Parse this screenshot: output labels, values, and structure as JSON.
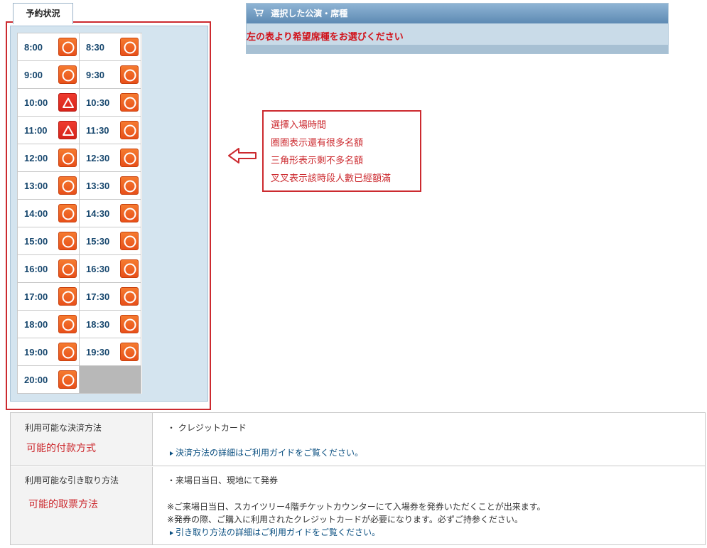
{
  "tab": {
    "label": "予約状況"
  },
  "schedule": {
    "rows": [
      [
        {
          "time": "8:00",
          "status": "circle"
        },
        {
          "time": "8:30",
          "status": "circle"
        }
      ],
      [
        {
          "time": "9:00",
          "status": "circle"
        },
        {
          "time": "9:30",
          "status": "circle"
        }
      ],
      [
        {
          "time": "10:00",
          "status": "triangle"
        },
        {
          "time": "10:30",
          "status": "circle"
        }
      ],
      [
        {
          "time": "11:00",
          "status": "triangle"
        },
        {
          "time": "11:30",
          "status": "circle"
        }
      ],
      [
        {
          "time": "12:00",
          "status": "circle"
        },
        {
          "time": "12:30",
          "status": "circle"
        }
      ],
      [
        {
          "time": "13:00",
          "status": "circle"
        },
        {
          "time": "13:30",
          "status": "circle"
        }
      ],
      [
        {
          "time": "14:00",
          "status": "circle"
        },
        {
          "time": "14:30",
          "status": "circle"
        }
      ],
      [
        {
          "time": "15:00",
          "status": "circle"
        },
        {
          "time": "15:30",
          "status": "circle"
        }
      ],
      [
        {
          "time": "16:00",
          "status": "circle"
        },
        {
          "time": "16:30",
          "status": "circle"
        }
      ],
      [
        {
          "time": "17:00",
          "status": "circle"
        },
        {
          "time": "17:30",
          "status": "circle"
        }
      ],
      [
        {
          "time": "18:00",
          "status": "circle"
        },
        {
          "time": "18:30",
          "status": "circle"
        }
      ],
      [
        {
          "time": "19:00",
          "status": "circle"
        },
        {
          "time": "19:30",
          "status": "circle"
        }
      ],
      [
        {
          "time": "20:00",
          "status": "circle"
        },
        null
      ]
    ]
  },
  "selection": {
    "header": "選択した公演・席種",
    "message": "左の表より希望席種をお選びください",
    "icon": "cart-icon"
  },
  "annotation": {
    "lines": [
      "選擇入場時間",
      "圈圈表示還有很多名額",
      "三角形表示剩不多名額",
      "叉叉表示該時段人數已經額滿"
    ],
    "arrow_icon": "left-arrow-icon"
  },
  "info_table": {
    "payment": {
      "label": "利用可能な決済方法",
      "note": "可能的付款方式",
      "value": "・ クレジットカード",
      "link": "決済方法の詳細はご利用ガイドをご覧ください。"
    },
    "pickup": {
      "label": "利用可能な引き取り方法",
      "note": "可能的取票方法",
      "value": "・来場日当日、現地にて発券",
      "detail1": "※ご来場日当日、スカイツリー4階チケットカウンターにて入場券を発券いただくことが出来ます。",
      "detail2": "※発券の際、ご購入に利用されたクレジットカードが必要になります。必ずご持参ください。",
      "link": "引き取り方法の詳細はご利用ガイドをご覧ください。"
    }
  },
  "colors": {
    "accent_red": "#cc2a2f",
    "circle_badge": "#e8501a",
    "triangle_badge": "#d6231a",
    "panel_blue": "#d4e4ef",
    "link": "#0a4f80"
  }
}
